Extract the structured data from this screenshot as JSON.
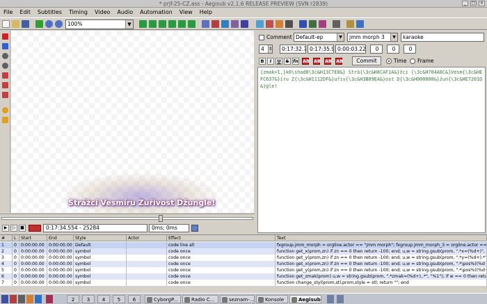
{
  "window": {
    "title": "* prjf-25-CZ.ass - Aegisub v2.1.6 RELEASE PREVIEW (SVN r2839)"
  },
  "menu": [
    "File",
    "Edit",
    "Subtitles",
    "Timing",
    "Video",
    "Audio",
    "Automation",
    "View",
    "Help"
  ],
  "toolbar": {
    "zoom": "100%"
  },
  "video": {
    "subtitle_preview": "Strážci Vesmíru Zuřivost Džungle!"
  },
  "video_controls": {
    "time": "0:17:34.554 - 25284",
    "zoom_time": "0ms; 0ms"
  },
  "edit": {
    "comment_label": "Comment",
    "style": "Default-ep",
    "actor": "jmm morph 3",
    "effect": "karaoke",
    "layer": "4",
    "start": "0:17:32.76",
    "end": "0:17:35.98",
    "duration": "0:00:03.22",
    "margin_l": "0",
    "margin_r": "0",
    "margin_v": "0",
    "format_buttons": [
      "B",
      "I",
      "U",
      "S",
      "fn",
      "AB",
      "AB",
      "AB",
      "AB"
    ],
    "commit_label": "Commit",
    "time_label": "Time",
    "frame_label": "Frame",
    "text": "{zmak=1,}k0\\shad0\\3c&H13C7E8&} Strá{\\3c&H8CAF1A&}žci {\\3c&H704A8C&}Vesm{\\3c&HEFC637&}íru Z{\\3c&H1112DF&}uřiv{\\3c&H3B89EA&}ost D{\\3c&H000000&}žun{\\3c&HE7201D&}gle!"
  },
  "grid": {
    "columns": [
      "#",
      "L",
      "Start",
      "End",
      "Style",
      "Actor",
      "Effect",
      "Text"
    ],
    "rows": [
      {
        "n": "1",
        "l": "0",
        "start": "0:00:00.00",
        "end": "0:00:00.00",
        "style": "Default",
        "actor": "",
        "effect": "code line all",
        "text": "fxgroup.jmm_morph = orgline.actor == \"jmm morph\"; fxgroup.jmm_morph_3 = orgline.actor =="
      },
      {
        "n": "2",
        "l": "0",
        "start": "0:00:00.00",
        "end": "0:00:00.00",
        "style": "symbol",
        "actor": "",
        "effect": "code once",
        "text": "function get_x(prom,zn) if zn == 0 then return -100; end; u,w = string.gsub(prom, \".*x=(%d+)\","
      },
      {
        "n": "3",
        "l": "0",
        "start": "0:00:00.00",
        "end": "0:00:00.00",
        "style": "symbol",
        "actor": "",
        "effect": "code once",
        "text": "function get_y(prom,zn) if zn == 0 then return -100; end; u,w = string.gsub(prom, \".*y=(%d+).*\""
      },
      {
        "n": "4",
        "l": "0",
        "start": "0:00:00.00",
        "end": "0:00:00.00",
        "style": "symbol",
        "actor": "",
        "effect": "code once",
        "text": "function get_x(prom,zn) if zn == 0 then return -100; end; u,w = string.gsub(prom, \".*\\pos%((%d"
      },
      {
        "n": "5",
        "l": "0",
        "start": "0:00:00.00",
        "end": "0:00:00.00",
        "style": "symbol",
        "actor": "",
        "effect": "code once",
        "text": "function get_y(prom,zn) if zn == 0 then return -100; end; u,w = string.gsub(prom, \".*\\pos%((%d+"
      },
      {
        "n": "6",
        "l": "0",
        "start": "0:00:00.00",
        "end": "0:00:00.00",
        "style": "symbol",
        "actor": "",
        "effect": "code once",
        "text": "function get_zmak(prom) u,w = string.gsub(prom, \".*zmak=(%d+),.*\", \"%1\"); if w == 0 then retu"
      },
      {
        "n": "7",
        "l": "0",
        "start": "0:00:00.00",
        "end": "0:00:00.00",
        "style": "symbol",
        "actor": "",
        "effect": "code once",
        "text": "function change_styl(prom,stl,prom,style = stl; return \"\"; end"
      }
    ]
  },
  "taskbar": {
    "workspaces": [
      "2",
      "3",
      "4",
      "5",
      "6"
    ],
    "apps": [
      "CyborgP...",
      "Radio C...",
      "seznam-...",
      "Konsole",
      "Aegisub"
    ]
  },
  "colors": {
    "selected_row": "#c6d3f0",
    "alt_row": "#dfe4f6",
    "override_text": "#3a7a3a"
  }
}
